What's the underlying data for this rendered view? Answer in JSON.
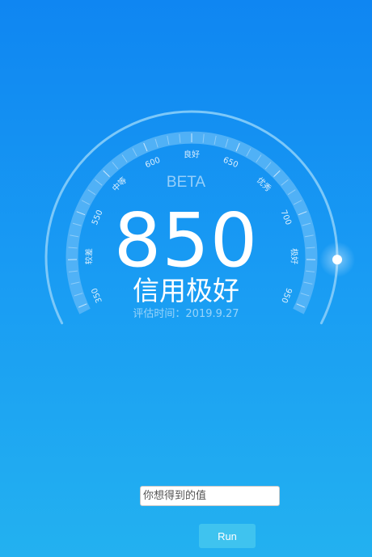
{
  "gauge": {
    "label": "BETA",
    "score": "850",
    "level": "信用极好",
    "date_text": "评估时间：2019.9.27",
    "ticks": [
      {
        "text": "350"
      },
      {
        "text": "较差"
      },
      {
        "text": "550"
      },
      {
        "text": "中等"
      },
      {
        "text": "600"
      },
      {
        "text": "良好"
      },
      {
        "text": "650"
      },
      {
        "text": "优秀"
      },
      {
        "text": "700"
      },
      {
        "text": "极好"
      },
      {
        "text": "950"
      }
    ],
    "colors": {
      "track": "#5ab6f7",
      "outer_arc": "#7cc8f9",
      "indicator": "#ffffff"
    }
  },
  "form": {
    "placeholder": "你想得到的值",
    "run_label": "Run"
  }
}
